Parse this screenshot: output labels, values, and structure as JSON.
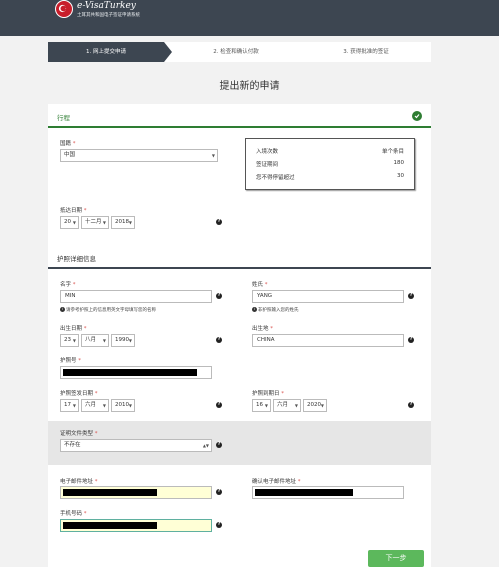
{
  "header": {
    "brand_title": "e-VisaTurkey",
    "brand_subtitle": "土耳其共和国电子签证申请系统",
    "bg_color": "#3d4651"
  },
  "steps": [
    {
      "label": "1. 网上提交申请",
      "active": true
    },
    {
      "label": "2. 检查和确认付款",
      "active": false
    },
    {
      "label": "3. 获得批准的签证",
      "active": false
    }
  ],
  "page_title": "提出新的申请",
  "trip": {
    "section_title": "行程",
    "complete_icon": "check-icon",
    "country_label": "国籍",
    "country_value": "中国",
    "arrival_label": "抵达日期",
    "arrival_day": "20",
    "arrival_month": "十二月",
    "arrival_year": "2018",
    "info": [
      {
        "key": "入境次数",
        "value": "单个条目"
      },
      {
        "key": "签证期间",
        "value": "180"
      },
      {
        "key": "您不得停留超过",
        "value": "30"
      }
    ]
  },
  "passport": {
    "section_title": "护照详细信息",
    "given_name_label": "名字",
    "given_name_value": "MIN",
    "given_name_hint": "请参考护照上的信息用英文字母填写您的名称",
    "surname_label": "姓氏",
    "surname_value": "YANG",
    "surname_hint": "非护照输入您的姓氏",
    "dob_label": "出生日期",
    "dob_day": "23",
    "dob_month": "八月",
    "dob_year": "1990",
    "pob_label": "出生地",
    "pob_value": "CHINA",
    "passport_no_label": "护照号",
    "issue_label": "护照签发日期",
    "issue_day": "17",
    "issue_month": "六月",
    "issue_year": "2010",
    "expiry_label": "护照到期日",
    "expiry_day": "16",
    "expiry_month": "六月",
    "expiry_year": "2020",
    "doc_type_label": "证明文件类型",
    "doc_type_value": "不存在",
    "email_label": "电子邮件地址",
    "confirm_email_label": "确认电子邮件地址",
    "phone_label": "手机号码"
  },
  "required_mark": "*",
  "help_glyph": "?",
  "hint_glyph": "i",
  "next_button": "下一步",
  "colors": {
    "accent_green": "#2e7d32",
    "button_green": "#5cb85c",
    "required_red": "#d9534f"
  }
}
